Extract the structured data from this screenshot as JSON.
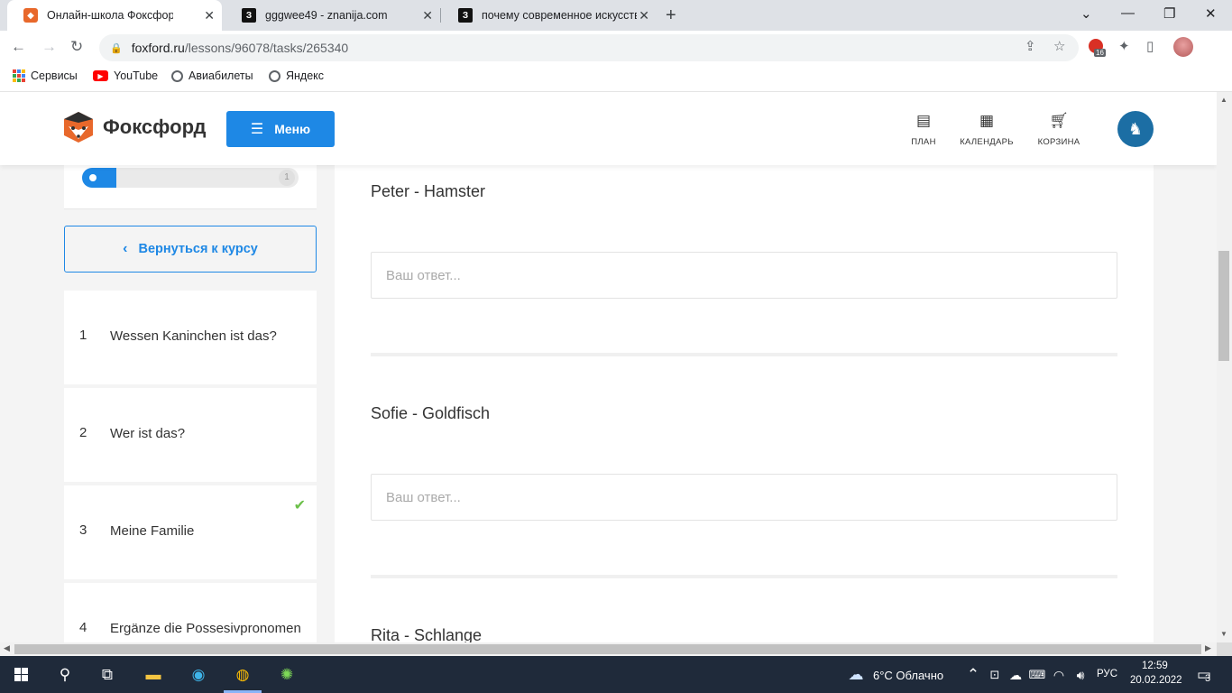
{
  "browser": {
    "tabs": [
      {
        "title": "Онлайн-школа Фоксфорд",
        "active": true
      },
      {
        "title": "gggwee49 - znanija.com",
        "active": false
      },
      {
        "title": "почему современное искусство",
        "active": false
      }
    ],
    "url_host": "foxford.ru",
    "url_path": "/lessons/96078/tasks/265340",
    "extension_badge": "16",
    "bookmarks": [
      "Сервисы",
      "YouTube",
      "Авиабилеты",
      "Яндекс"
    ]
  },
  "header": {
    "logo_text": "Фоксфорд",
    "menu_label": "Меню",
    "nav": [
      {
        "label": "ПЛАН",
        "icon": "list-icon"
      },
      {
        "label": "КАЛЕНДАРЬ",
        "icon": "calendar-icon"
      },
      {
        "label": "КОРЗИНА",
        "icon": "cart-icon"
      }
    ]
  },
  "sidebar": {
    "progress_fraction": 0.16,
    "progress_end_label": "1",
    "back_label": "Вернуться к курсу",
    "lessons": [
      {
        "num": "1",
        "label": "Wessen Kaninchen ist das?",
        "done": false
      },
      {
        "num": "2",
        "label": "Wer ist das?",
        "done": false
      },
      {
        "num": "3",
        "label": "Meine Familie",
        "done": true
      },
      {
        "num": "4",
        "label": "Ergänze die Possesivpronomen",
        "done": false
      }
    ]
  },
  "task": {
    "questions": [
      {
        "prompt": "Peter - Hamster",
        "value": "",
        "placeholder": "Ваш ответ..."
      },
      {
        "prompt": "Sofie - Goldfisch",
        "value": "",
        "placeholder": "Ваш ответ..."
      },
      {
        "prompt": "Rita - Schlange"
      }
    ]
  },
  "taskbar": {
    "weather": "6°C Облачно",
    "language": "РУС",
    "time": "12:59",
    "date": "20.02.2022",
    "notifications": "3"
  },
  "colors": {
    "brand_blue": "#1e88e5",
    "check_green": "#6cc04a",
    "fox_orange": "#e8682b"
  }
}
